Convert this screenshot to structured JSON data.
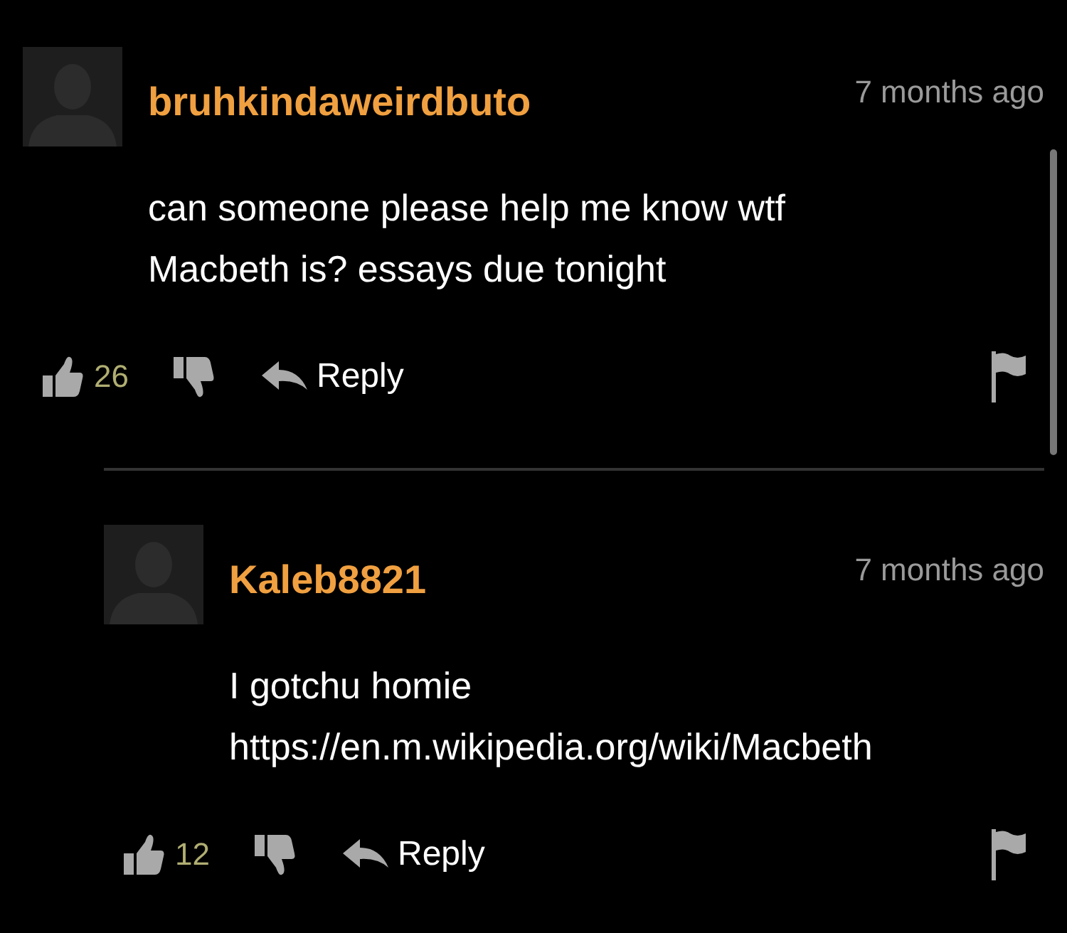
{
  "comments": [
    {
      "username": "bruhkindaweirdbuto",
      "time": "7 months ago",
      "body": [
        "can someone please help me know wtf",
        "Macbeth is? essays due tonight"
      ],
      "likes": "26",
      "reply_label": "Reply",
      "children": [
        {
          "username": "Kaleb8821",
          "time": "7 months ago",
          "body": [
            "I gotchu homie",
            "https://en.m.wikipedia.org/wiki/Macbeth"
          ],
          "likes": "12",
          "reply_label": "Reply"
        }
      ]
    }
  ]
}
